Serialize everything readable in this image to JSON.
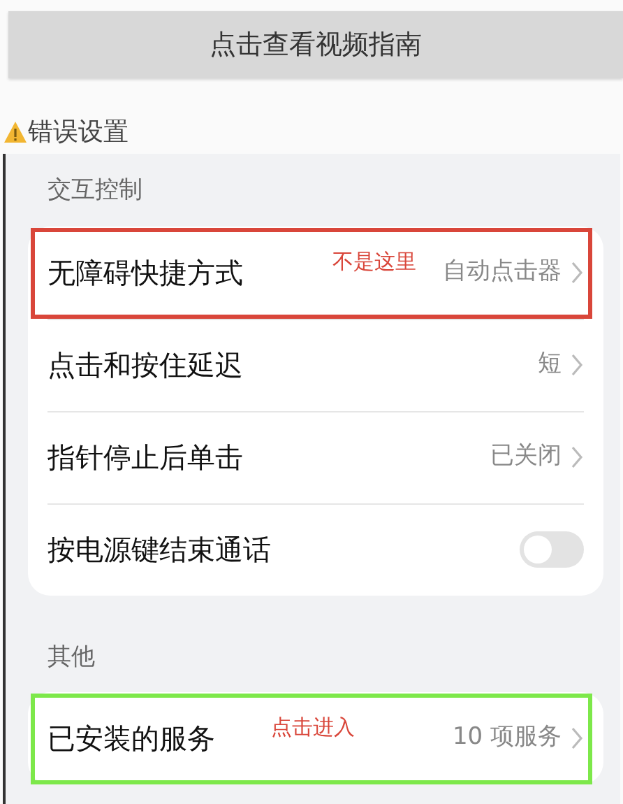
{
  "guide_button": {
    "label": "点击查看视频指南"
  },
  "warning": {
    "label": "错误设置"
  },
  "sections": [
    {
      "title": "交互控制",
      "rows": [
        {
          "kind": "link",
          "label": "无障碍快捷方式",
          "value": "自动点击器",
          "highlight": {
            "color": "#d9463a",
            "note": "不是这里"
          }
        },
        {
          "kind": "link",
          "label": "点击和按住延迟",
          "value": "短"
        },
        {
          "kind": "link",
          "label": "指针停止后单击",
          "value": "已关闭"
        },
        {
          "kind": "toggle",
          "label": "按电源键结束通话",
          "on": false
        }
      ]
    },
    {
      "title": "其他",
      "rows": [
        {
          "kind": "link",
          "label": "已安装的服务",
          "value": "10 项服务",
          "highlight": {
            "color": "#7de84a",
            "note": "点击进入"
          }
        }
      ]
    }
  ]
}
